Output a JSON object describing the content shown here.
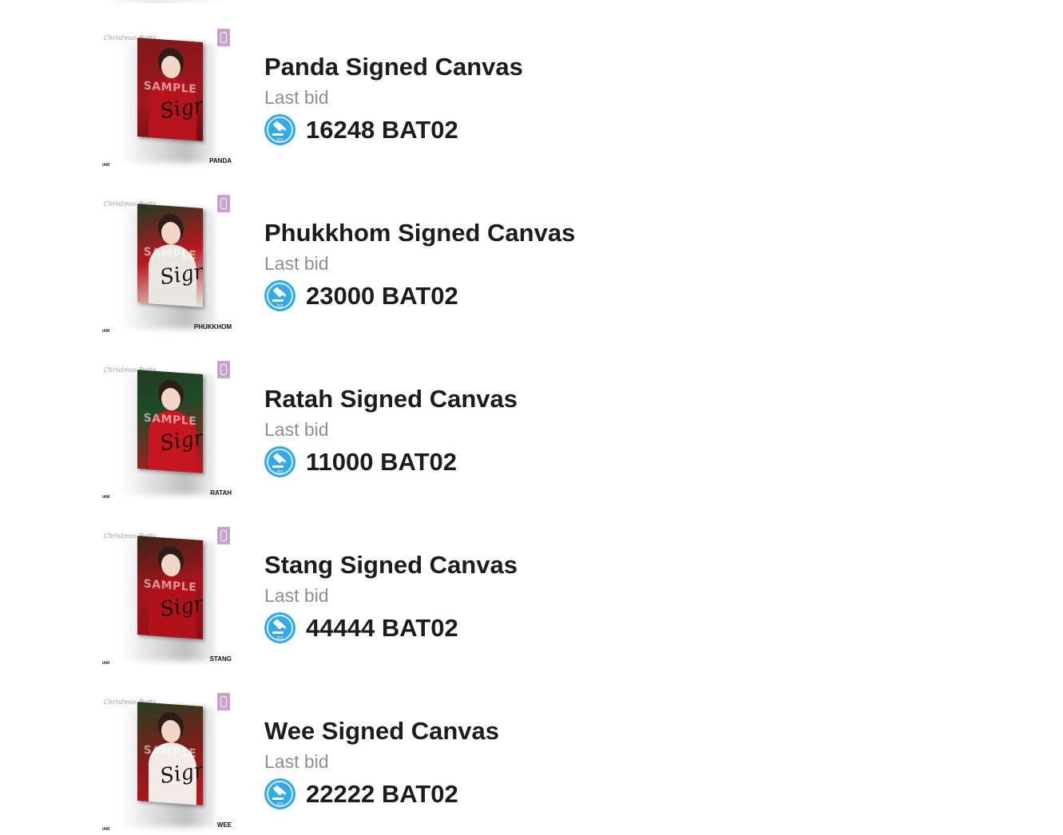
{
  "colors": {
    "title": "#1c1c1e",
    "subtitle": "#8e8e93",
    "bid_icon": "#35a9e3",
    "tag": "#c9a3cd"
  },
  "items": [
    {
      "title": "Panda Signed Canvas",
      "subtitle": "Last bid",
      "bid": "16248 BAT02",
      "icon": "gavel-coin-icon",
      "thumb": {
        "header": "Christmas Party",
        "watermark": "SAMPLE",
        "signature": "Sign",
        "member": "PANDA",
        "brand": "iAM",
        "coin_label": "02"
      }
    },
    {
      "title": "Phukkhom Signed Canvas",
      "subtitle": "Last bid",
      "bid": "23000 BAT02",
      "icon": "gavel-coin-icon",
      "thumb": {
        "header": "Christmas Party",
        "watermark": "SAMPLE",
        "signature": "Sign",
        "member": "PHUKKHOM",
        "brand": "iAM",
        "coin_label": "02"
      }
    },
    {
      "title": "Ratah Signed Canvas",
      "subtitle": "Last bid",
      "bid": "11000 BAT02",
      "icon": "gavel-coin-icon",
      "thumb": {
        "header": "Christmas Party",
        "watermark": "SAMPLE",
        "signature": "Sign",
        "member": "RATAH",
        "brand": "iAM",
        "coin_label": "02"
      }
    },
    {
      "title": "Stang Signed Canvas",
      "subtitle": "Last bid",
      "bid": "44444 BAT02",
      "icon": "gavel-coin-icon",
      "thumb": {
        "header": "Christmas Party",
        "watermark": "SAMPLE",
        "signature": "Sign",
        "member": "STANG",
        "brand": "iAM",
        "coin_label": "02"
      }
    },
    {
      "title": "Wee Signed Canvas",
      "subtitle": "Last bid",
      "bid": "22222 BAT02",
      "icon": "gavel-coin-icon",
      "thumb": {
        "header": "Christmas Party",
        "watermark": "SAMPLE",
        "signature": "Sign.",
        "member": "WEE",
        "brand": "iAM",
        "coin_label": "02"
      }
    }
  ]
}
